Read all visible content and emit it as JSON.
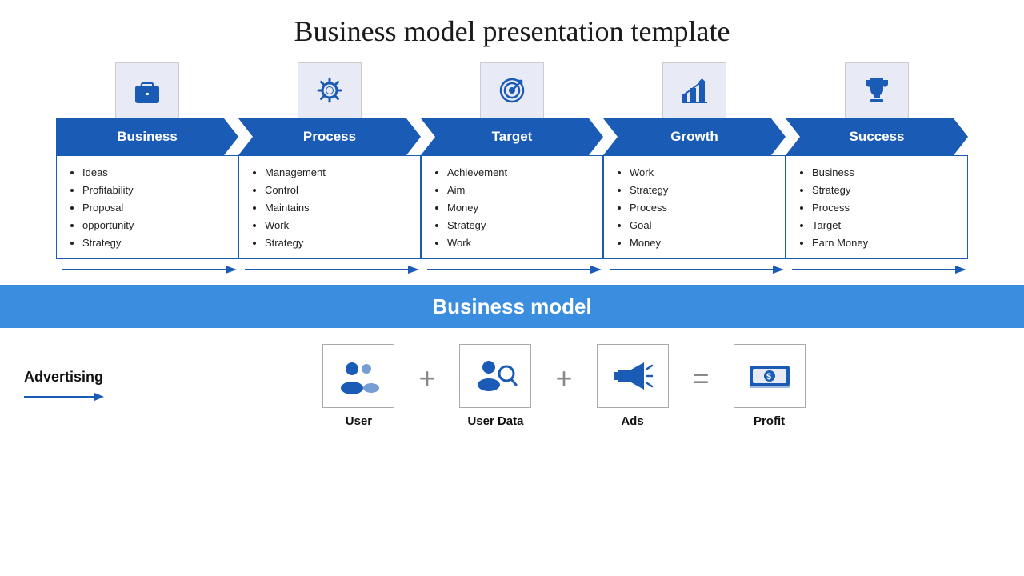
{
  "title": "Business model presentation template",
  "columns": [
    {
      "id": "business",
      "label": "Business",
      "icon": "briefcase",
      "items": [
        "Ideas",
        "Profitability",
        "Proposal",
        "opportunity",
        "Strategy"
      ]
    },
    {
      "id": "process",
      "label": "Process",
      "icon": "gear",
      "items": [
        "Management",
        "Control",
        "Maintains",
        "Work",
        "Strategy"
      ]
    },
    {
      "id": "target",
      "label": "Target",
      "icon": "target",
      "items": [
        "Achievement",
        "Aim",
        "Money",
        "Strategy",
        "Work"
      ]
    },
    {
      "id": "growth",
      "label": "Growth",
      "icon": "chart",
      "items": [
        "Work",
        "Strategy",
        "Process",
        "Goal",
        "Money"
      ]
    },
    {
      "id": "success",
      "label": "Success",
      "icon": "trophy",
      "items": [
        "Business",
        "Strategy",
        "Process",
        "Target",
        "Earn Money"
      ]
    }
  ],
  "bm_banner": "Business model",
  "advertising_label": "Advertising",
  "bottom_items": [
    {
      "id": "user",
      "label": "User",
      "icon": "users"
    },
    {
      "id": "user-data",
      "label": "User Data",
      "icon": "search-users"
    },
    {
      "id": "ads",
      "label": "Ads",
      "icon": "megaphone"
    },
    {
      "id": "profit",
      "label": "Profit",
      "icon": "money"
    }
  ],
  "operators": [
    "+",
    "+",
    "="
  ]
}
